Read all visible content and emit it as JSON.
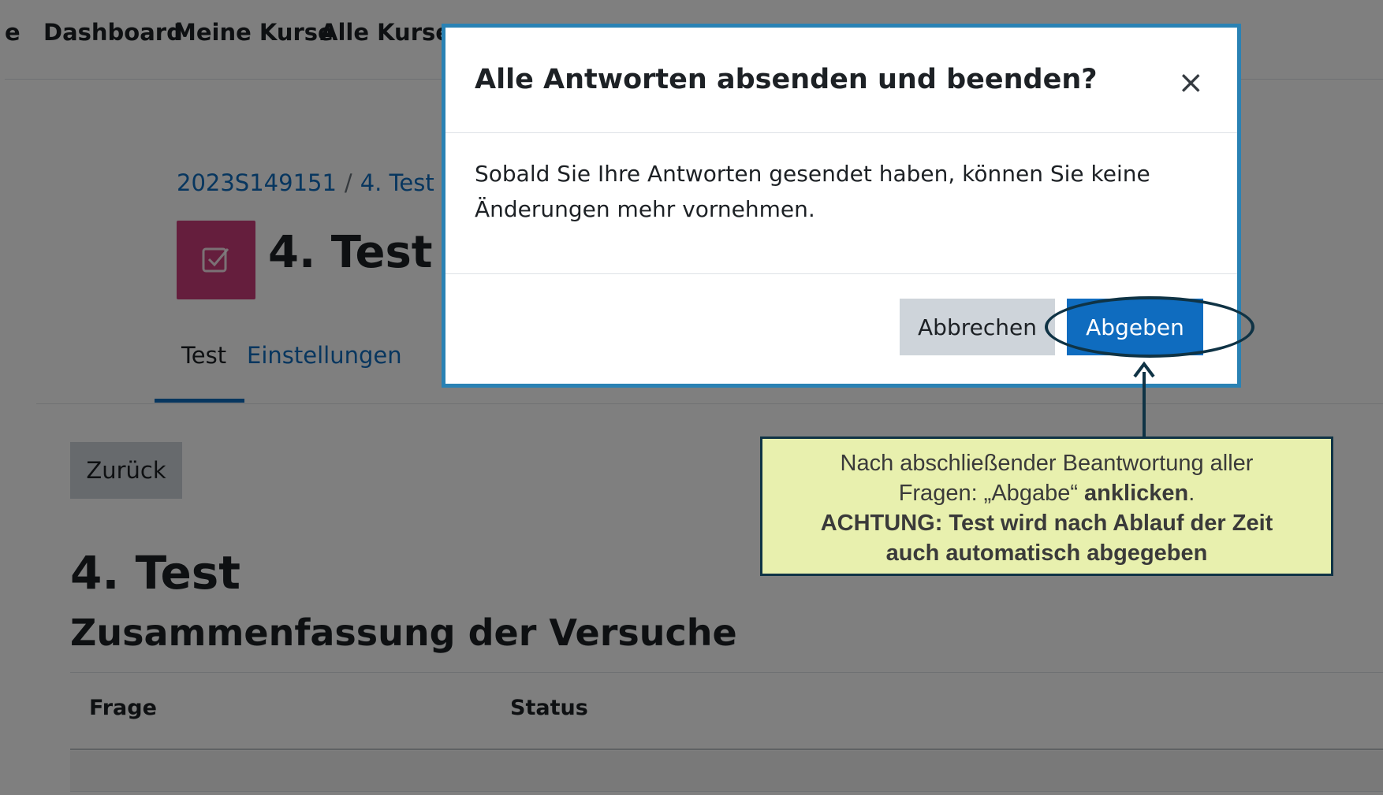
{
  "navbar": {
    "cut_item": "e",
    "items": [
      "Dashboard",
      "Meine Kurse",
      "Alle Kurse"
    ]
  },
  "breadcrumb": [
    "2023S149151",
    "4. Test"
  ],
  "header": {
    "title": "4. Test",
    "icon": "checkbox-icon",
    "icon_color": "#cb3d7a"
  },
  "tabs": [
    {
      "label": "Test",
      "active": true
    },
    {
      "label": "Einstellungen",
      "active": false
    }
  ],
  "back_button": "Zurück",
  "main": {
    "title": "4. Test",
    "subtitle": "Zusammenfassung der Versuche",
    "table": {
      "columns": [
        "Frage",
        "Status"
      ]
    }
  },
  "modal": {
    "title": "Alle Antworten absenden und beenden?",
    "close_symbol": "×",
    "body_line1": "Sobald Sie Ihre Antworten gesendet haben, können Sie keine",
    "body_line2": "Änderungen mehr vornehmen.",
    "cancel_label": "Abbrechen",
    "submit_label": "Abgeben",
    "accent": "#0f6cbf"
  },
  "annotation": {
    "line1": "Nach abschließender Beantwortung aller",
    "line2_prefix": "Fragen: „Abgabe“ ",
    "line2_bold": "anklicken",
    "line2_suffix": ".",
    "line3": "ACHTUNG: Test wird nach Ablauf der Zeit",
    "line4": "auch automatisch abgegeben",
    "background": "#e8f0ae"
  }
}
